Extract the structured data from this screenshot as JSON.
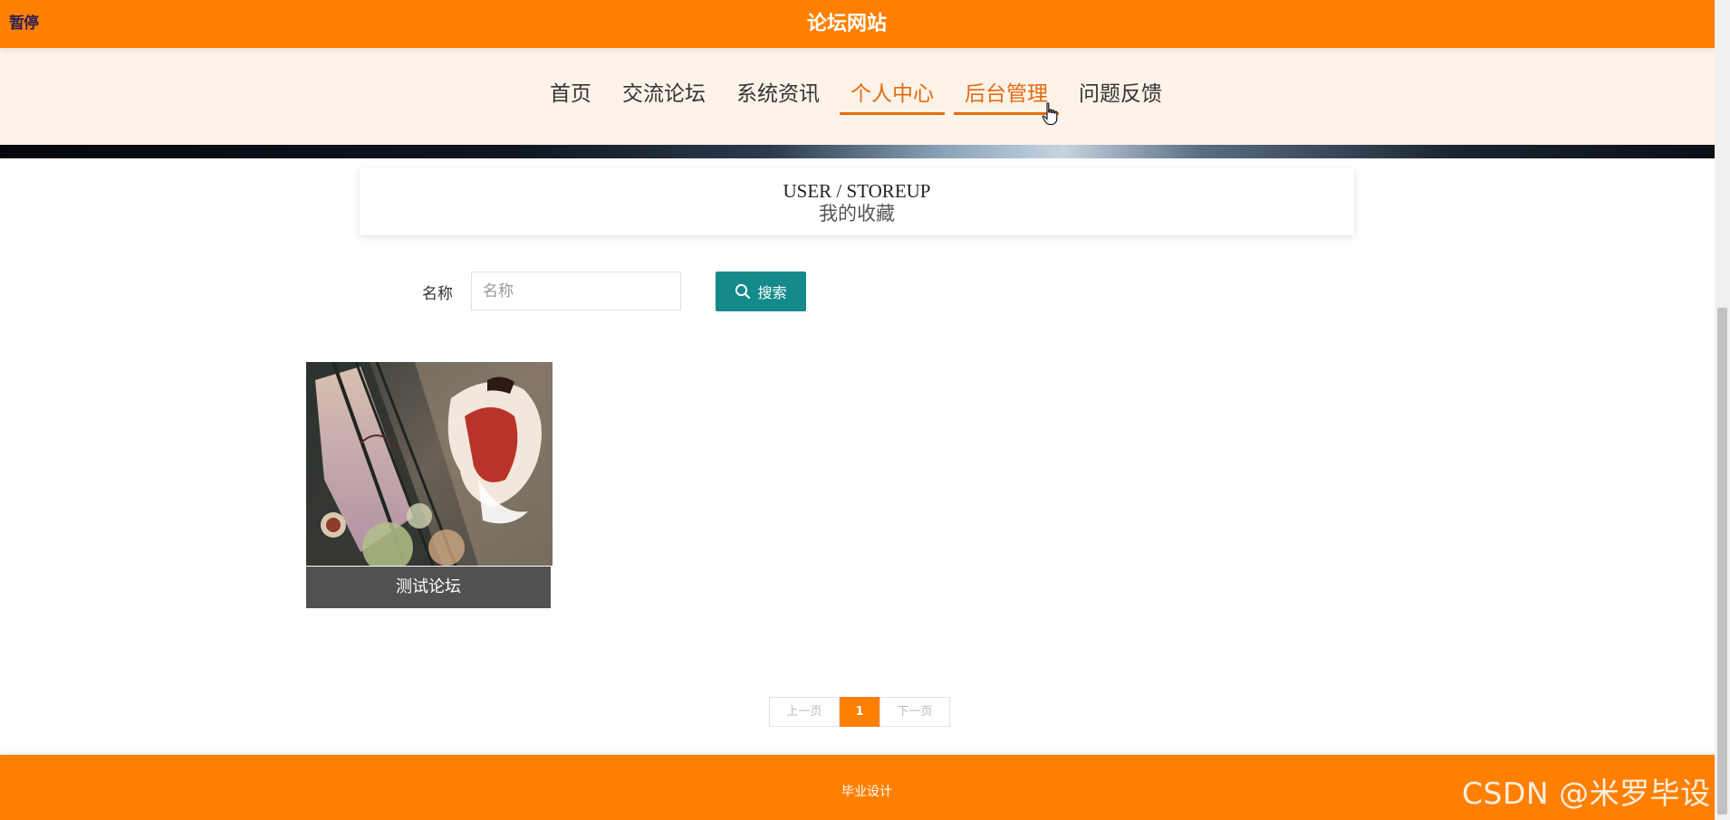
{
  "header": {
    "pause_label": "暂停",
    "site_title": "论坛网站"
  },
  "nav": {
    "items": [
      {
        "label": "首页",
        "active": false
      },
      {
        "label": "交流论坛",
        "active": false
      },
      {
        "label": "系统资讯",
        "active": false
      },
      {
        "label": "个人中心",
        "active": true
      },
      {
        "label": "后台管理",
        "active": true
      },
      {
        "label": "问题反馈",
        "active": false
      }
    ]
  },
  "section": {
    "title_en": "USER / STOREUP",
    "title_cn": "我的收藏"
  },
  "search": {
    "label": "名称",
    "placeholder": "名称",
    "value": "",
    "button_label": "搜索",
    "button_icon": "search-icon"
  },
  "favorites": [
    {
      "title": "测试论坛"
    }
  ],
  "pagination": {
    "prev_label": "上一页",
    "current_page": "1",
    "next_label": "下一页"
  },
  "footer": {
    "text": "毕业设计"
  },
  "watermark": "CSDN @米罗毕设",
  "colors": {
    "brand_orange": "#ff7f00",
    "nav_active": "#e76a10",
    "nav_background": "#fdf3e8",
    "search_button": "#148b8a",
    "card_caption": "#515151"
  }
}
